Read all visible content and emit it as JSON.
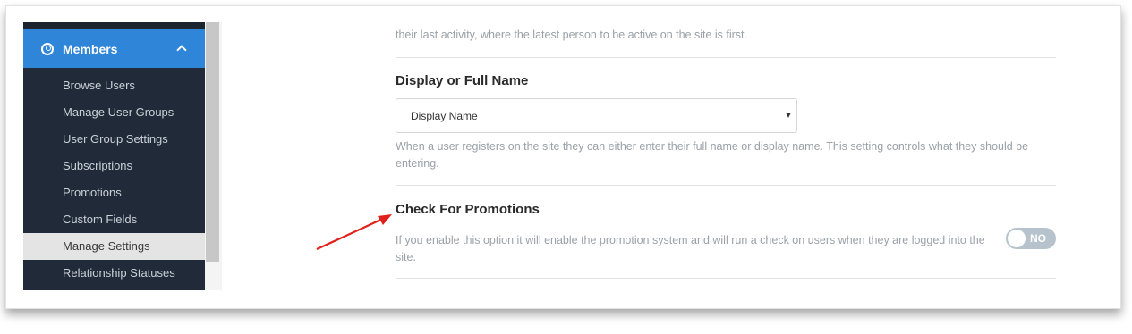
{
  "sidebar": {
    "section_label": "Members",
    "items": [
      {
        "label": "Browse Users"
      },
      {
        "label": "Manage User Groups"
      },
      {
        "label": "User Group Settings"
      },
      {
        "label": "Subscriptions"
      },
      {
        "label": "Promotions"
      },
      {
        "label": "Custom Fields"
      },
      {
        "label": "Manage Settings",
        "active": true
      },
      {
        "label": "Relationship Statuses"
      }
    ]
  },
  "settings": {
    "previous_desc_tail": "their last activity, where the latest person to be active on the site is first.",
    "display_name": {
      "title": "Display or Full Name",
      "selected": "Display Name",
      "description": "When a user registers on the site they can either enter their full name or display name. This setting controls what they should be entering."
    },
    "promotions": {
      "title": "Check For Promotions",
      "description": "If you enable this option it will enable the promotion system and will run a check on users when they are logged into the site.",
      "toggle_label": "NO",
      "toggle_on": false
    }
  },
  "colors": {
    "sidebar_bg": "#212a38",
    "accent": "#2f85d8",
    "active_item_bg": "#e4e4e4",
    "annotation_arrow": "#e0201b",
    "toggle_off": "#b6c3cc"
  },
  "icons": {
    "members": "user-circle-icon",
    "collapse": "chevron-up-icon",
    "dropdown": "caret-down-icon"
  }
}
